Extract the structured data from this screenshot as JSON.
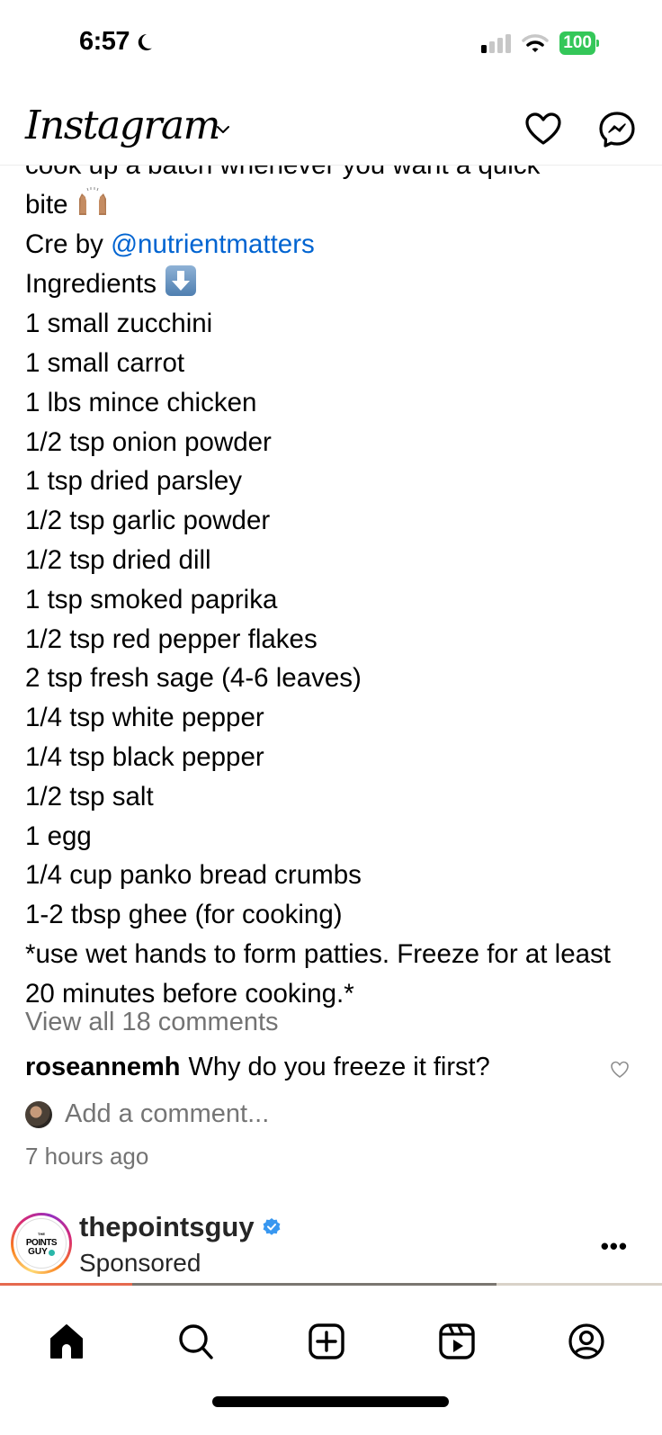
{
  "status_bar": {
    "time": "6:57",
    "focus_icon": "moon-icon",
    "signal_bars_on": 1,
    "signal_bars_total": 4,
    "wifi_icon": "wifi-icon",
    "battery": "100",
    "battery_color": "#34c759"
  },
  "header": {
    "logo": "Instagram",
    "chevron_icon": "chevron-down-icon",
    "notifications_icon": "heart-icon",
    "messages_icon": "messenger-icon"
  },
  "caption": {
    "partial_top_line": "cook up a batch whenever you want a quick",
    "line_bite": "bite",
    "credit_prefix": "Cre by",
    "credit_mention": "@nutrientmatters",
    "ingredients_label": "Ingredients",
    "ingredients": [
      "1 small zucchini",
      "1 small carrot",
      "1 lbs mince chicken",
      "1/2 tsp onion powder",
      "1 tsp dried parsley",
      "1/2 tsp garlic powder",
      "1/2 tsp dried dill",
      "1 tsp smoked paprika",
      "1/2 tsp red pepper flakes",
      "2 tsp fresh sage (4-6 leaves)",
      "1/4 tsp white pepper",
      "1/4 tsp black pepper",
      "1/2 tsp salt",
      "1 egg",
      "1/4 cup panko bread crumbs",
      "1-2 tbsp ghee (for cooking)"
    ],
    "note": "*use wet hands to form patties. Freeze for at least 20 minutes before cooking.*",
    "mention_color": "#0064d1"
  },
  "comments": {
    "view_all": "View all 18 comments",
    "top_comment": {
      "username": "roseannemh",
      "text": "Why do you freeze it first?"
    },
    "add_placeholder": "Add a comment...",
    "timestamp": "7 hours ago"
  },
  "next_post": {
    "username": "thepointsguy",
    "verified": true,
    "label": "Sponsored",
    "avatar_text": [
      "THE",
      "POINTS",
      "GUY"
    ],
    "more_label": "•••"
  },
  "tab_bar": {
    "items": [
      {
        "name": "home",
        "icon": "home-icon",
        "active": true
      },
      {
        "name": "search",
        "icon": "search-icon",
        "active": false
      },
      {
        "name": "create",
        "icon": "plus-square-icon",
        "active": false
      },
      {
        "name": "reels",
        "icon": "reels-icon",
        "active": false
      },
      {
        "name": "profile",
        "icon": "profile-icon",
        "active": false
      }
    ]
  }
}
